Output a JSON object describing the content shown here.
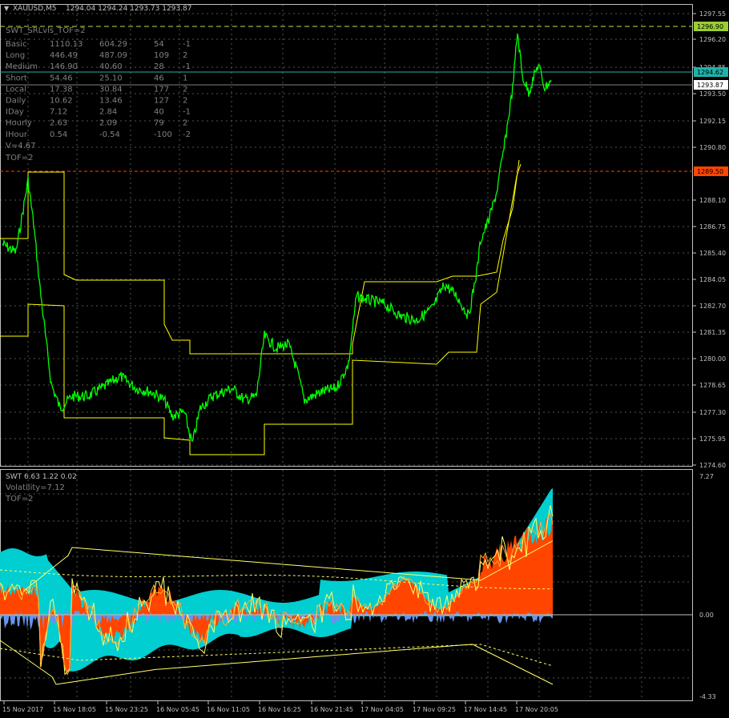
{
  "header": {
    "symbol": "XAUUSD,M5",
    "ohlc": "1294.04 1294.24 1293.73 1293.87"
  },
  "price_indicator": {
    "title": "SWT_SRLvls_TOF=2",
    "rows": [
      [
        "Basic",
        "1110.13",
        "604.29",
        "54",
        "-1"
      ],
      [
        "Long",
        "446.49",
        "487.09",
        "109",
        "2"
      ],
      [
        "Medium",
        "146.90",
        "40.60",
        "28",
        "-1"
      ],
      [
        "Short",
        "54.46",
        "25.10",
        "46",
        "1"
      ],
      [
        "Local",
        "17.38",
        "30.84",
        "177",
        "2"
      ],
      [
        "Daily",
        "10.62",
        "13.46",
        "127",
        "2"
      ],
      [
        "IDay",
        "7.12",
        "2.84",
        "40",
        "-1"
      ],
      [
        "Hourly",
        "2.63",
        "2.09",
        "79",
        "2"
      ],
      [
        "IHour",
        "0.54",
        "-0.54",
        "-100",
        "-2"
      ]
    ],
    "v_text": "V=4.67",
    "tof_text": "TOF=2"
  },
  "price_axis": {
    "ticks": [
      "1297.55",
      "1296.20",
      "1294.85",
      "1293.50",
      "1292.15",
      "1290.80",
      "1288.10",
      "1286.75",
      "1285.40",
      "1284.05",
      "1282.70",
      "1281.35",
      "1280.00",
      "1278.65",
      "1277.30",
      "1275.95",
      "1274.60"
    ],
    "tags": [
      {
        "label": "1296.90",
        "bg": "#9acd32",
        "fg": "#000000"
      },
      {
        "label": "1294.62",
        "bg": "#20b2aa",
        "fg": "#000000"
      },
      {
        "label": "1293.87",
        "bg": "#ffffff",
        "fg": "#000000"
      },
      {
        "label": "1289.50",
        "bg": "#ff4500",
        "fg": "#000000"
      }
    ]
  },
  "sub_window": {
    "title": "SWT 6.63 1.22 0.02",
    "volatility": "Volatility=7.12",
    "tof": "TOF=2",
    "axis": [
      "7.27",
      "0.00",
      "-4.33"
    ]
  },
  "time_axis": [
    "15 Nov 2017",
    "15 Nov 18:05",
    "15 Nov 23:25",
    "16 Nov 05:45",
    "16 Nov 11:05",
    "16 Nov 16:25",
    "16 Nov 21:45",
    "17 Nov 04:05",
    "17 Nov 09:25",
    "17 Nov 14:45",
    "17 Nov 20:05"
  ],
  "colors": {
    "price_line": "#00ff00",
    "level": "#ffff00",
    "cyan_area": "#00ced1",
    "orange_area": "#ff4500",
    "blue_area": "#6495ed",
    "grid": "#4a5a4a",
    "text": "#c0c0c0"
  }
}
